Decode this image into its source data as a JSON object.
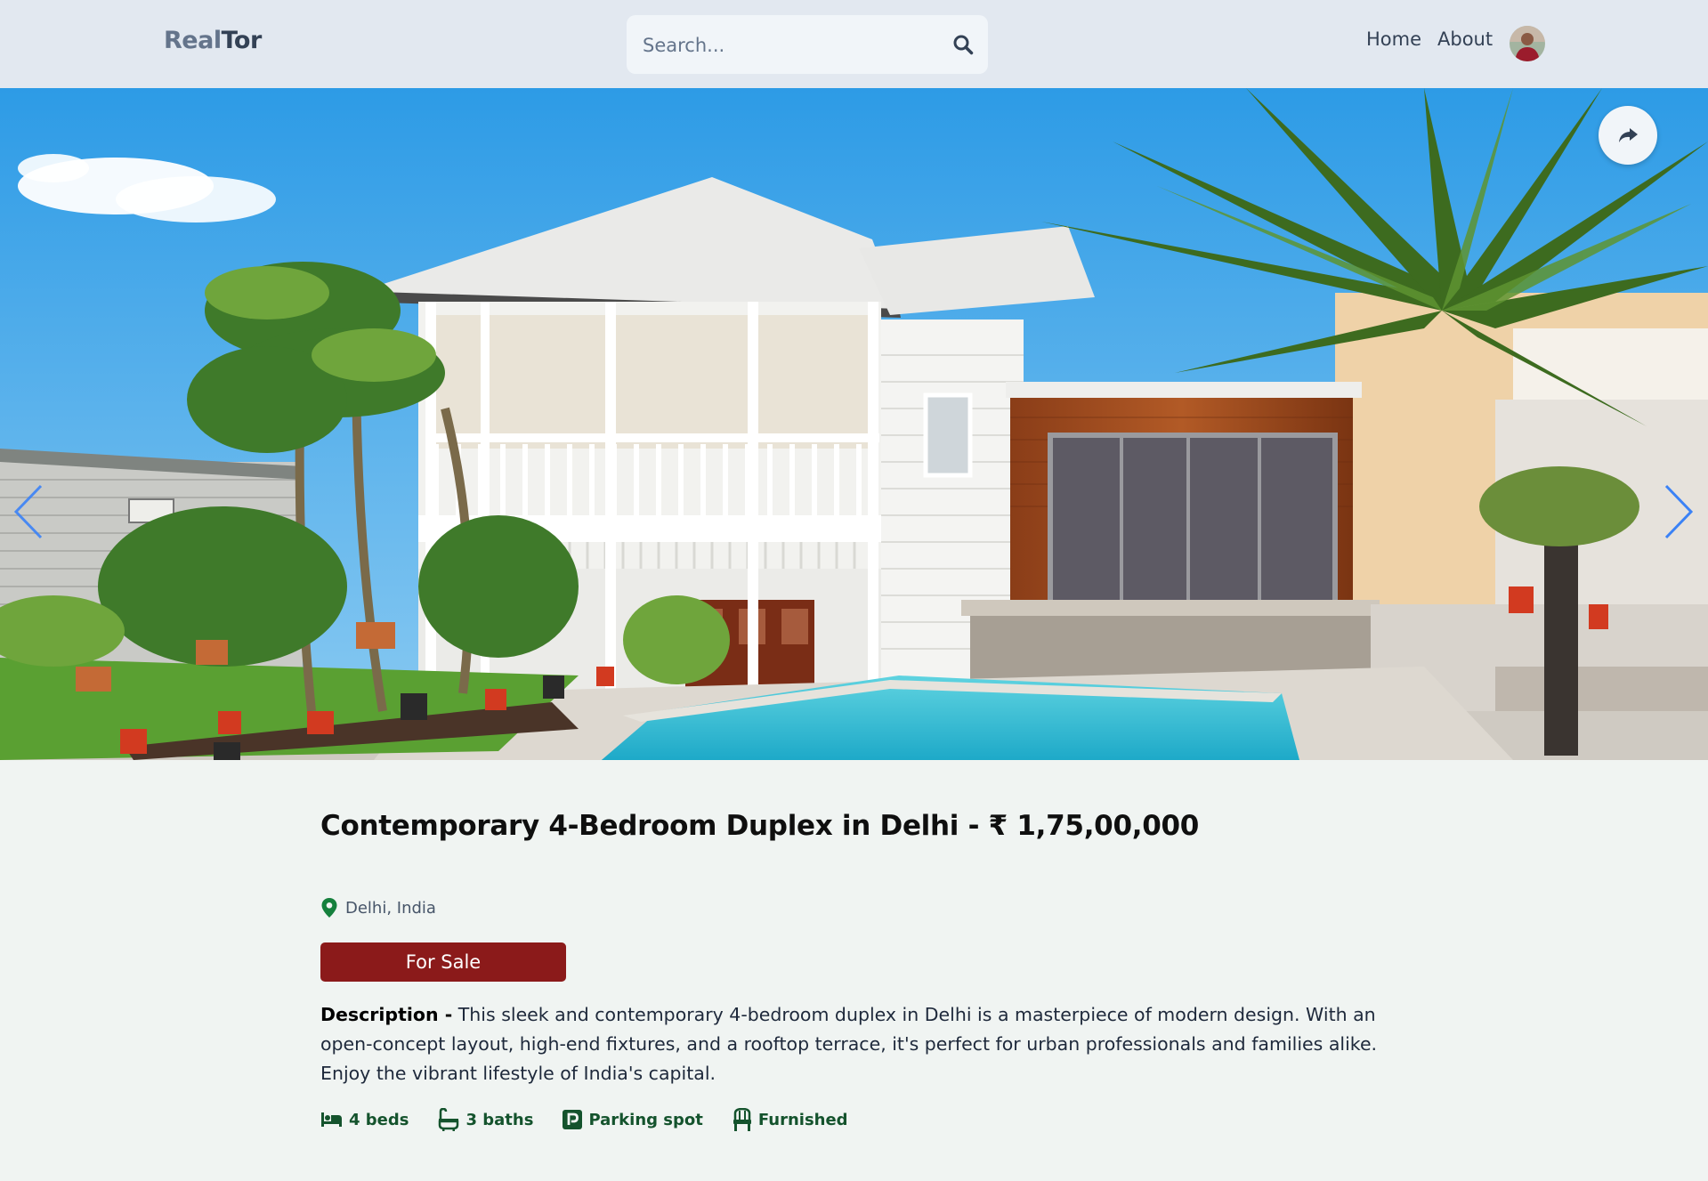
{
  "header": {
    "logo_part1": "Real",
    "logo_part2": "Tor",
    "search_placeholder": "Search...",
    "nav": [
      {
        "label": "Home"
      },
      {
        "label": "About"
      }
    ]
  },
  "hero": {
    "icons": [
      "chevron-left-icon",
      "chevron-right-icon",
      "share-icon"
    ]
  },
  "listing": {
    "title": "Contemporary 4-Bedroom Duplex in Delhi - ₹ 1,75,00,000",
    "location": "Delhi, India",
    "status": "For Sale",
    "description_label": "Description -",
    "description": "This sleek and contemporary 4-bedroom duplex in Delhi is a masterpiece of modern design. With an open-concept layout, high-end fixtures, and a rooftop terrace, it's perfect for urban professionals and families alike. Enjoy the vibrant lifestyle of India's capital.",
    "features": [
      {
        "label": "4 beds",
        "icon": "bed-icon"
      },
      {
        "label": "3 baths",
        "icon": "bath-icon"
      },
      {
        "label": "Parking spot",
        "icon": "parking-icon"
      },
      {
        "label": "Furnished",
        "icon": "chair-icon"
      }
    ]
  },
  "colors": {
    "header_bg": "#e2e8f0",
    "page_bg": "#f0f4f2",
    "badge_bg": "#8b1a1a",
    "feature_green": "#14532d",
    "pin_green": "#15803d",
    "arrow_blue": "#3b82f6"
  }
}
